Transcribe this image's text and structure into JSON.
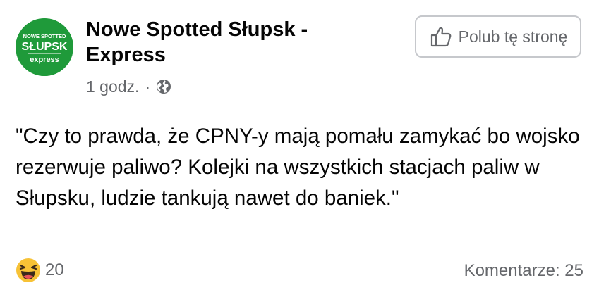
{
  "page": {
    "avatar_text": {
      "top": "NOWE SPOTTED",
      "middle": "SŁUPSK",
      "bottom": "express"
    },
    "name": "Nowe Spotted Słupsk - Express",
    "time": "1 godz.",
    "separator": "·",
    "privacy_icon": "globe-icon",
    "like_page_label": "Polub tę stronę",
    "like_page_icon": "thumbs-up-icon"
  },
  "post": {
    "text": "\"Czy to prawda, że CPNY-y mają pomału zamykać bo wojsko rezerwuje paliwo? Kolejki na wszystkich stacjach paliw w Słupsku, ludzie tankują nawet do baniek.\""
  },
  "footer": {
    "reaction_icon": "haha-emoji-icon",
    "reaction_count": "20",
    "comments_label": "Komentarze: 25"
  },
  "colors": {
    "avatar_green": "#1f9a3a",
    "secondary_text": "#65676b",
    "button_border": "#c6c8cc",
    "haha_yellow": "#f7c236"
  }
}
